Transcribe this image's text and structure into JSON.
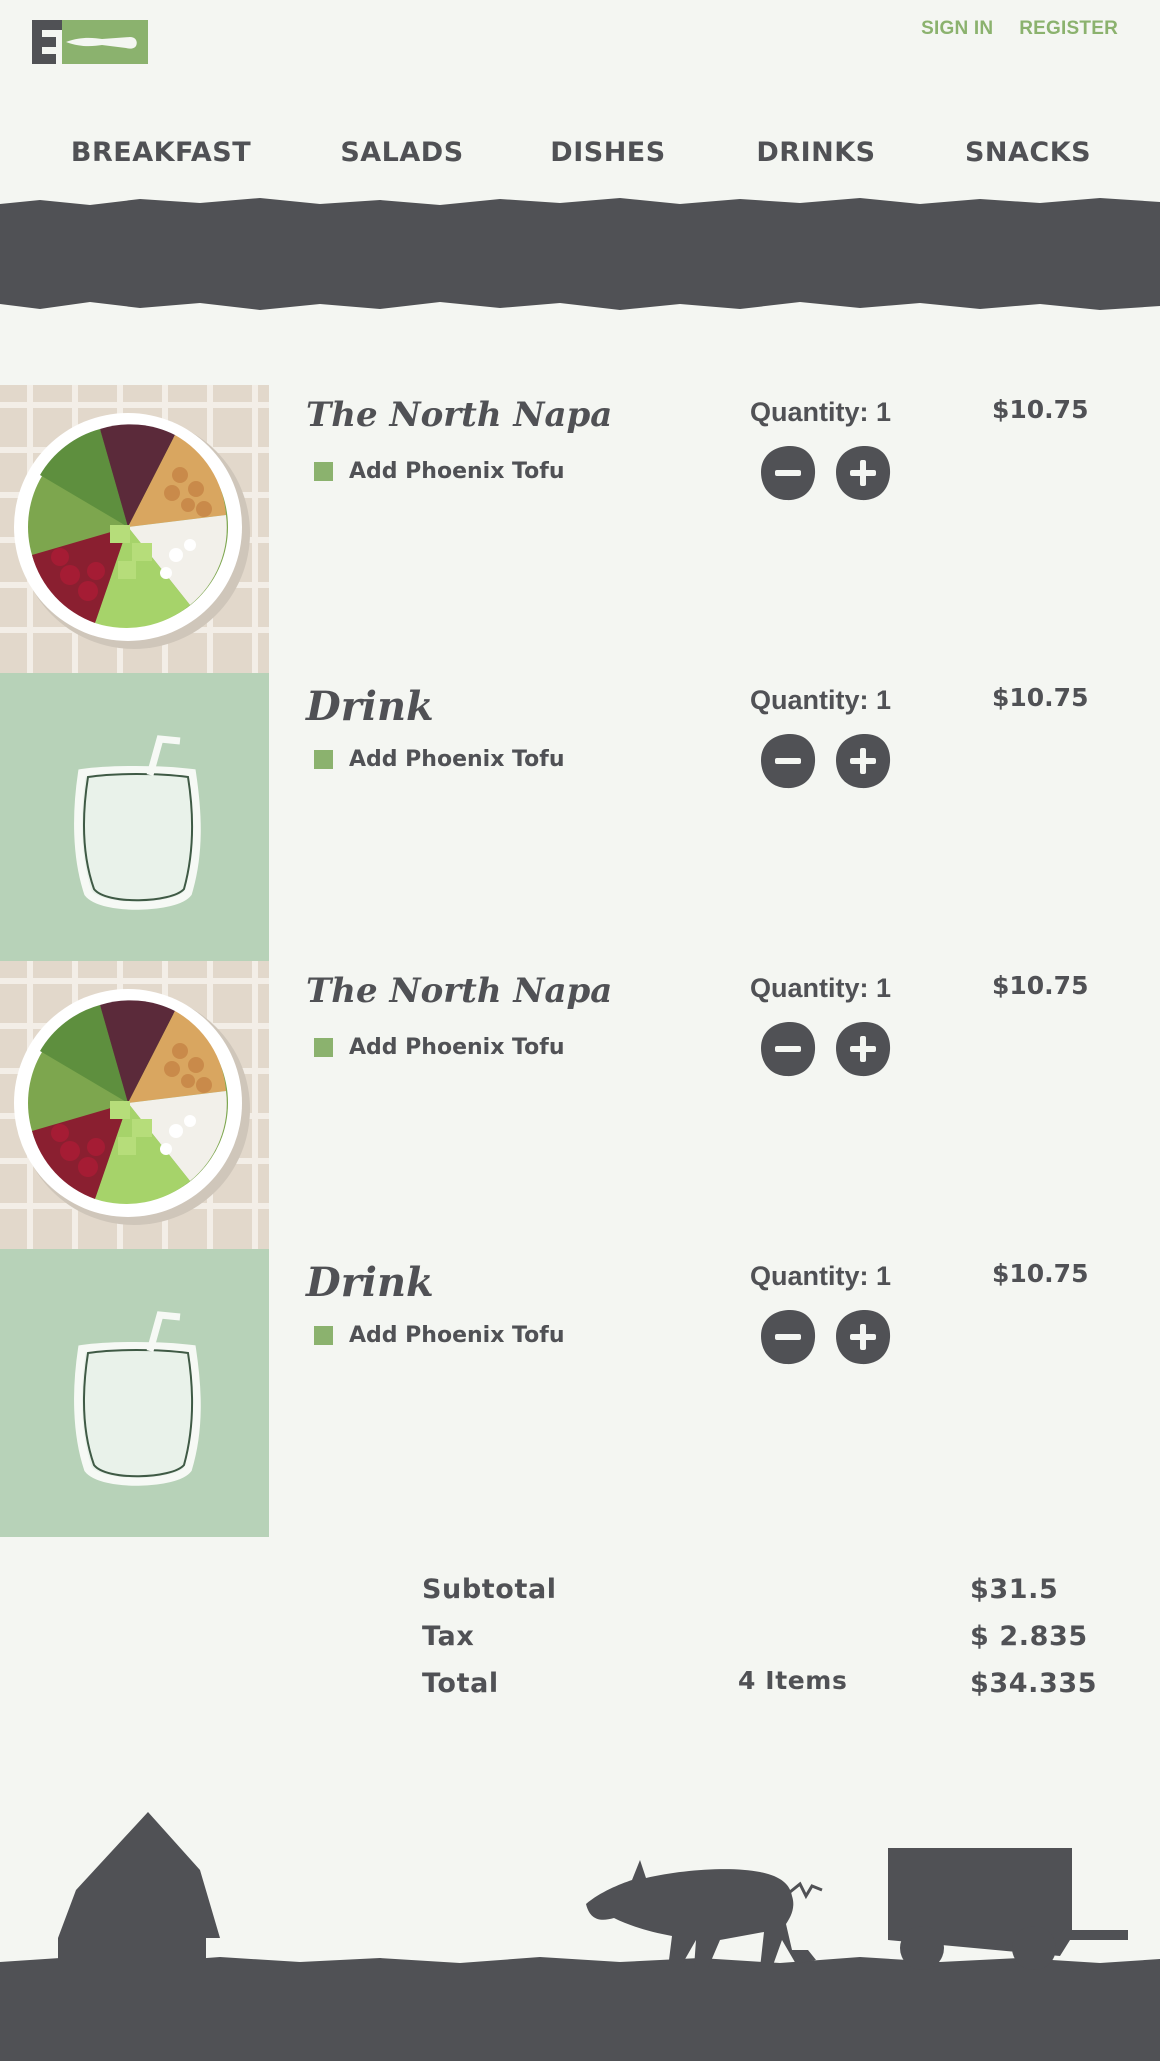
{
  "header": {
    "logo_icon": "fork-icon",
    "sign_in": "SIGN IN",
    "register": "REGISTER"
  },
  "nav": {
    "items": [
      "BREAKFAST",
      "SALADS",
      "DISHES",
      "DRINKS",
      "SNACKS"
    ]
  },
  "cart": {
    "items": [
      {
        "name": "The North Napa",
        "image": "salad-bowl-image",
        "addon": "Add Phoenix Tofu",
        "quantity": "Quantity: 1",
        "price": "$10.75"
      },
      {
        "name": "Drink",
        "image": "drink-glass-image",
        "addon": "Add Phoenix Tofu",
        "quantity": "Quantity: 1",
        "price": "$10.75"
      },
      {
        "name": "The North Napa",
        "image": "salad-bowl-image",
        "addon": "Add Phoenix Tofu",
        "quantity": "Quantity: 1",
        "price": "$10.75"
      },
      {
        "name": "Drink",
        "image": "drink-glass-image",
        "addon": "Add Phoenix Tofu",
        "quantity": "Quantity: 1",
        "price": "$10.75"
      }
    ]
  },
  "summary": {
    "subtotal_label": "Subtotal",
    "subtotal_value": "$31.5",
    "tax_label": "Tax",
    "tax_value": "$ 2.835",
    "total_label": "Total",
    "items_count": "4 Items",
    "total_value": "$34.335"
  },
  "colors": {
    "background": "#f4f6f2",
    "dark": "#505155",
    "accent_green": "#8bb26e",
    "drink_bg": "#b7d2b8"
  }
}
